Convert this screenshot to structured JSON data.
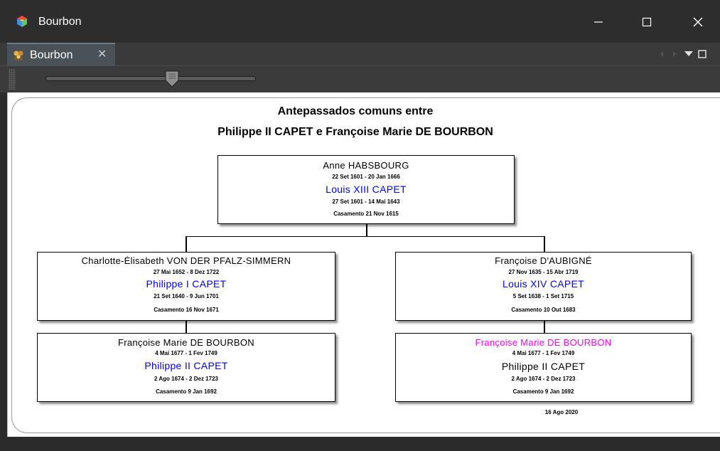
{
  "window": {
    "title": "Bourbon",
    "minimize_label": "—",
    "maximize_label": "☐",
    "close_label": "✕"
  },
  "tab": {
    "label": "Bourbon",
    "close_label": "✕"
  },
  "zoom_slider": {
    "value": 0.6
  },
  "tree": {
    "title_line1": "Antepassados comuns entre",
    "title_line2": "Philippe II CAPET e Françoise Marie DE BOURBON",
    "root": {
      "name": "Anne HABSBOURG",
      "dates": "22 Set 1601 - 20 Jan 1666",
      "spouse": "Louis XIII CAPET",
      "spouse_dates": "27 Set 1601 - 14 Mai 1643",
      "marriage": "Casamento 21 Nov 1615"
    },
    "left_gen2": {
      "name": "Charlotte-Élisabeth VON DER PFALZ-SIMMERN",
      "dates": "27 Mai 1652 - 8 Dez 1722",
      "spouse": "Philippe I CAPET",
      "spouse_dates": "21 Set 1640 - 9 Jun 1701",
      "marriage": "Casamento 16 Nov 1671"
    },
    "right_gen2": {
      "name": "Françoise D'AUBIGNÉ",
      "dates": "27 Nov 1635 - 15 Abr 1719",
      "spouse": "Louis XIV CAPET",
      "spouse_dates": "5 Set 1638 - 1 Set 1715",
      "marriage": "Casamento 10 Out 1683"
    },
    "left_gen3": {
      "name": "Françoise Marie DE BOURBON",
      "dates": "4 Mai 1677 - 1 Fev 1749",
      "spouse": "Philippe II CAPET",
      "spouse_dates": "2 Ago 1674 - 2 Dez 1723",
      "marriage": "Casamento 9 Jan 1692"
    },
    "right_gen3": {
      "name": "Françoise Marie DE BOURBON",
      "dates": "4 Mai 1677 - 1 Fev 1749",
      "spouse": "Philippe II CAPET",
      "spouse_dates": "2 Ago 1674 - 2 Dez 1723",
      "marriage": "Casamento 9 Jan 1692"
    },
    "generated_date": "16 Ago 2020"
  },
  "colors": {
    "spouse": "#0000ff",
    "highlight": "#ff00ff",
    "titlebar": "#2d2d2d"
  }
}
